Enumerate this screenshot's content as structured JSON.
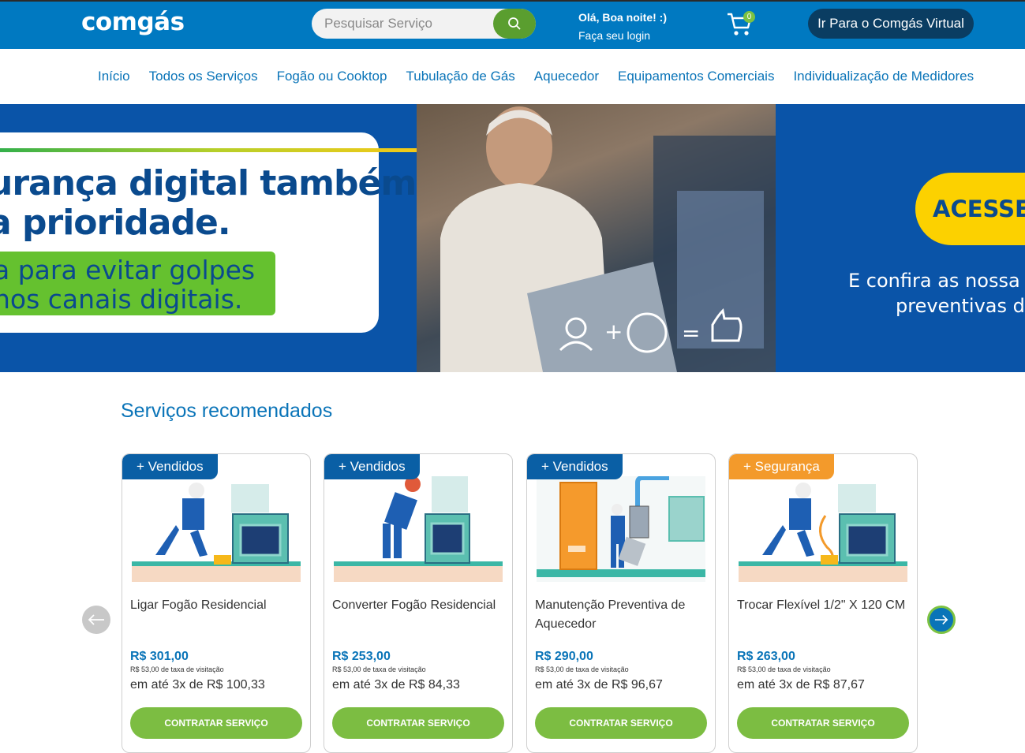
{
  "header": {
    "logo": "comgás",
    "search_placeholder": "Pesquisar Serviço",
    "greeting": "Olá, Boa noite! :)",
    "login": "Faça seu login",
    "cart_count": "0",
    "virtual_button": "Ir Para o Comgás Virtual"
  },
  "nav": [
    "Início",
    "Todos os Serviços",
    "Fogão ou Cooktop",
    "Tubulação de Gás",
    "Aquecedor",
    "Equipamentos Comerciais",
    "Individualização de Medidores"
  ],
  "banner": {
    "headline_1": "urança digital também",
    "headline_2": "a prioridade.",
    "sub_1": "a para evitar golpes",
    "sub_2": "nos canais digitais.",
    "acesse": "ACESSE",
    "right_1": "E confira as nossa",
    "right_2": "preventivas d"
  },
  "section_title": "Serviços recomendados",
  "cards": [
    {
      "tag": "+ Vendidos",
      "title": "Ligar Fogão Residencial",
      "price": "R$ 301,00",
      "fee": "R$ 53,00 de taxa de visitação",
      "installments": "em até 3x de R$ 100,33",
      "button": "CONTRATAR SERVIÇO"
    },
    {
      "tag": "+ Vendidos",
      "title": "Converter Fogão Residencial",
      "price": "R$ 253,00",
      "fee": "R$ 53,00 de taxa de visitação",
      "installments": "em até 3x de R$ 84,33",
      "button": "CONTRATAR SERVIÇO"
    },
    {
      "tag": "+ Vendidos",
      "title": "Manutenção Preventiva de Aquecedor",
      "price": "R$ 290,00",
      "fee": "R$ 53,00 de taxa de visitação",
      "installments": "em até 3x de R$ 96,67",
      "button": "CONTRATAR SERVIÇO"
    },
    {
      "tag": "+ Segurança",
      "title": "Trocar Flexível 1/2\" X 120 CM",
      "price": "R$ 263,00",
      "fee": "R$ 53,00 de taxa de visitação",
      "installments": "em até 3x de R$ 87,67",
      "button": "CONTRATAR SERVIÇO"
    }
  ]
}
